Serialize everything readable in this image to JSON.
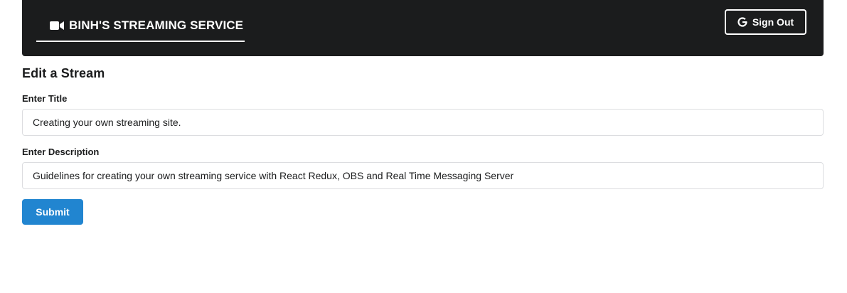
{
  "header": {
    "brand_title": "BINH'S STREAMING SERVICE",
    "brand_icon": "video-camera-icon",
    "sign_out_label": "Sign Out",
    "sign_out_icon": "google-icon",
    "background_color": "#1b1c1d"
  },
  "form": {
    "title": "Edit a Stream",
    "fields": [
      {
        "label": "Enter Title",
        "value": "Creating your own streaming site."
      },
      {
        "label": "Enter Description",
        "value": "Guidelines for creating your own streaming service with React Redux, OBS and Real Time Messaging Server"
      }
    ],
    "submit_label": "Submit",
    "submit_color": "#2185d0"
  }
}
